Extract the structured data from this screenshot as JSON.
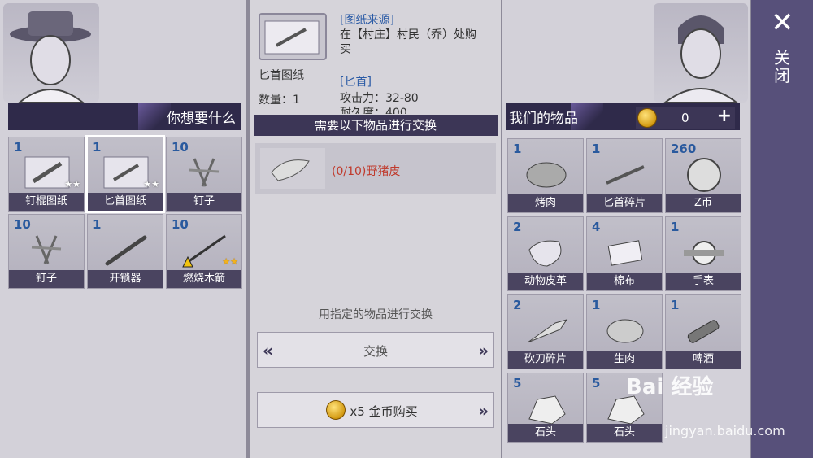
{
  "left": {
    "header": "你想要什么",
    "items": [
      {
        "count": "1",
        "label": "钉棍图纸",
        "icon": "blueprint-club-icon"
      },
      {
        "count": "1",
        "label": "匕首图纸",
        "icon": "blueprint-dagger-icon"
      },
      {
        "count": "10",
        "label": "钉子",
        "icon": "nails-icon"
      },
      {
        "count": "10",
        "label": "钉子",
        "icon": "nails-icon"
      },
      {
        "count": "1",
        "label": "开锁器",
        "icon": "lockpick-icon"
      },
      {
        "count": "10",
        "label": "燃烧木箭",
        "icon": "fire-arrow-icon"
      }
    ]
  },
  "recipe": {
    "name": "匕首图纸",
    "qty_label": "数量：1",
    "source_title": "[图纸来源]",
    "source_text": "在【村庄】村民（乔）处购买",
    "item_title": "[匕首]",
    "attack": "攻击力：32-80",
    "durability": "耐久度：400"
  },
  "exchange": {
    "need_header": "需要以下物品进行交换",
    "material": "(0/10)野猪皮",
    "hint": "用指定的物品进行交换",
    "exchange_label": "交换",
    "buy_label": "x5 金币购买"
  },
  "right": {
    "header": "我们的物品",
    "gold": "0",
    "items": [
      {
        "count": "1",
        "label": "烤肉"
      },
      {
        "count": "1",
        "label": "匕首碎片"
      },
      {
        "count": "260",
        "label": "Z币"
      },
      {
        "count": "2",
        "label": "动物皮革"
      },
      {
        "count": "4",
        "label": "棉布"
      },
      {
        "count": "1",
        "label": "手表"
      },
      {
        "count": "2",
        "label": "砍刀碎片"
      },
      {
        "count": "1",
        "label": "生肉"
      },
      {
        "count": "1",
        "label": "啤酒"
      },
      {
        "count": "5",
        "label": "石头"
      },
      {
        "count": "5",
        "label": "石头"
      }
    ]
  },
  "close_label": "关闭",
  "watermark": "Bai 经验",
  "watermark_url": "jingyan.baidu.com"
}
